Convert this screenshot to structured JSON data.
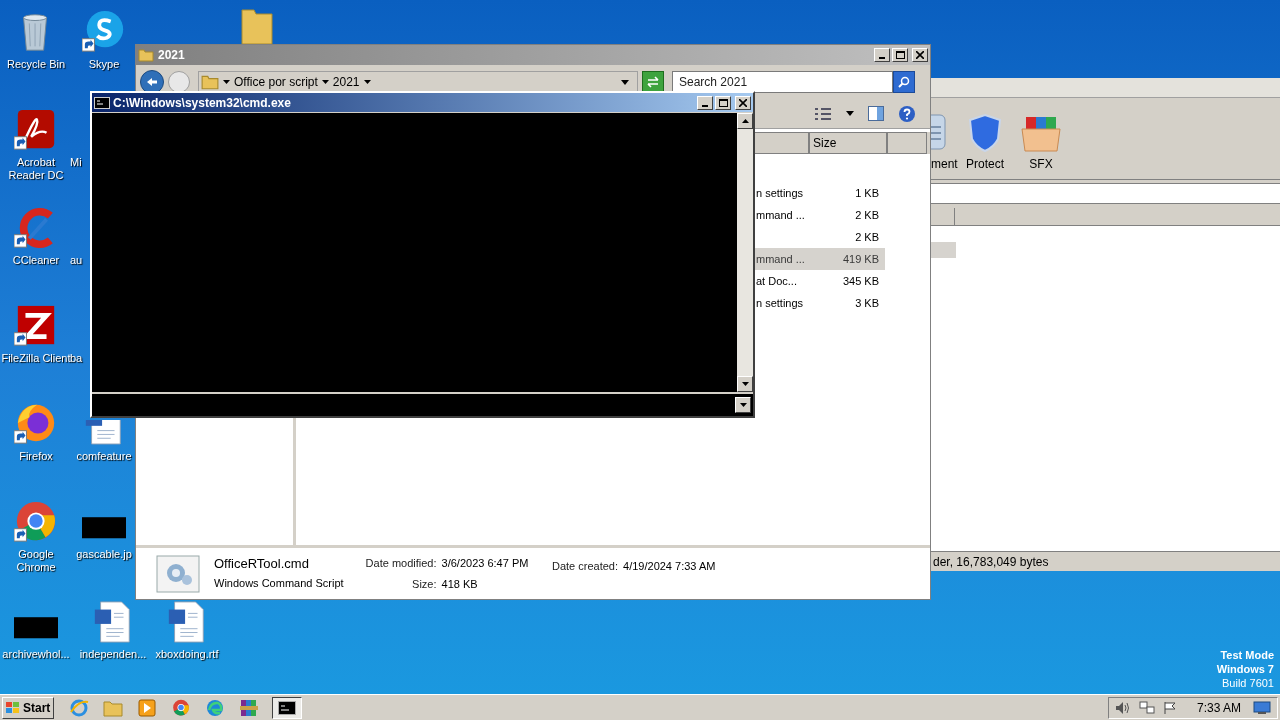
{
  "desktop": {
    "icons": [
      {
        "label": "Recycle Bin",
        "kind": "recycle",
        "shortcut": false
      },
      {
        "label": "Acrobat Reader DC",
        "kind": "acrobat",
        "shortcut": true
      },
      {
        "label": "CCleaner",
        "kind": "ccleaner",
        "shortcut": true
      },
      {
        "label": "FileZilla Client",
        "kind": "filezilla",
        "shortcut": true
      },
      {
        "label": "Firefox",
        "kind": "firefox",
        "shortcut": true
      },
      {
        "label": "Google Chrome",
        "kind": "chrome",
        "shortcut": true
      },
      {
        "label": "archivewhol...",
        "kind": "black",
        "shortcut": false
      },
      {
        "label": "Skype",
        "kind": "skype",
        "shortcut": true
      },
      {
        "label": "Mi",
        "kind": "covered"
      },
      {
        "label": "au",
        "kind": "covered"
      },
      {
        "label": "ba",
        "kind": "covered"
      },
      {
        "label": "comfeature",
        "kind": "word",
        "shortcut": false
      },
      {
        "label": "gascable.jp",
        "kind": "black",
        "shortcut": false
      },
      {
        "label": "independen...",
        "kind": "word",
        "shortcut": false
      },
      {
        "label": "xboxdoing.rtf",
        "kind": "word",
        "shortcut": false
      }
    ],
    "system_text": [
      "Test Mode",
      "Windows 7",
      "Build 7601"
    ]
  },
  "archive_window": {
    "toolbar": [
      {
        "label": "ment",
        "kind": "document"
      },
      {
        "label": "Protect",
        "kind": "shield"
      },
      {
        "label": "SFX",
        "kind": "box"
      }
    ],
    "status": "der, 16,783,049 bytes"
  },
  "explorer": {
    "title": "2021",
    "breadcrumbs": [
      "Office por script",
      "2021"
    ],
    "search": {
      "placeholder": "Search 2021"
    },
    "columns": [
      "Size"
    ],
    "rows": [
      {
        "type": "n settings",
        "size": "1 KB",
        "selected": false
      },
      {
        "type": "mmand ...",
        "size": "2 KB",
        "selected": false
      },
      {
        "size": "2 KB",
        "selected": false
      },
      {
        "type": "mmand ...",
        "size": "419 KB",
        "selected": true
      },
      {
        "type": "at Doc...",
        "size": "345 KB",
        "selected": false
      },
      {
        "type": "n settings",
        "size": "3 KB",
        "selected": false
      }
    ],
    "details": {
      "name": "OfficeRTool.cmd",
      "type": "Windows Command Script",
      "fields": [
        {
          "label": "Date modified:",
          "value": "3/6/2023 6:47 PM"
        },
        {
          "label": "Size:",
          "value": "418 KB"
        },
        {
          "label": "Date created:",
          "value": "4/19/2024 7:33 AM"
        }
      ]
    }
  },
  "console": {
    "title": "C:\\Windows\\system32\\cmd.exe"
  },
  "taskbar": {
    "start": "Start",
    "apps": [
      {
        "kind": "ie",
        "active": false
      },
      {
        "kind": "folder",
        "active": false
      },
      {
        "kind": "media",
        "active": false
      },
      {
        "kind": "chrome",
        "active": false
      },
      {
        "kind": "edge",
        "active": false
      },
      {
        "kind": "winrar",
        "active": false
      },
      {
        "kind": "cmd",
        "active": true
      }
    ],
    "clock": "7:33 AM"
  }
}
